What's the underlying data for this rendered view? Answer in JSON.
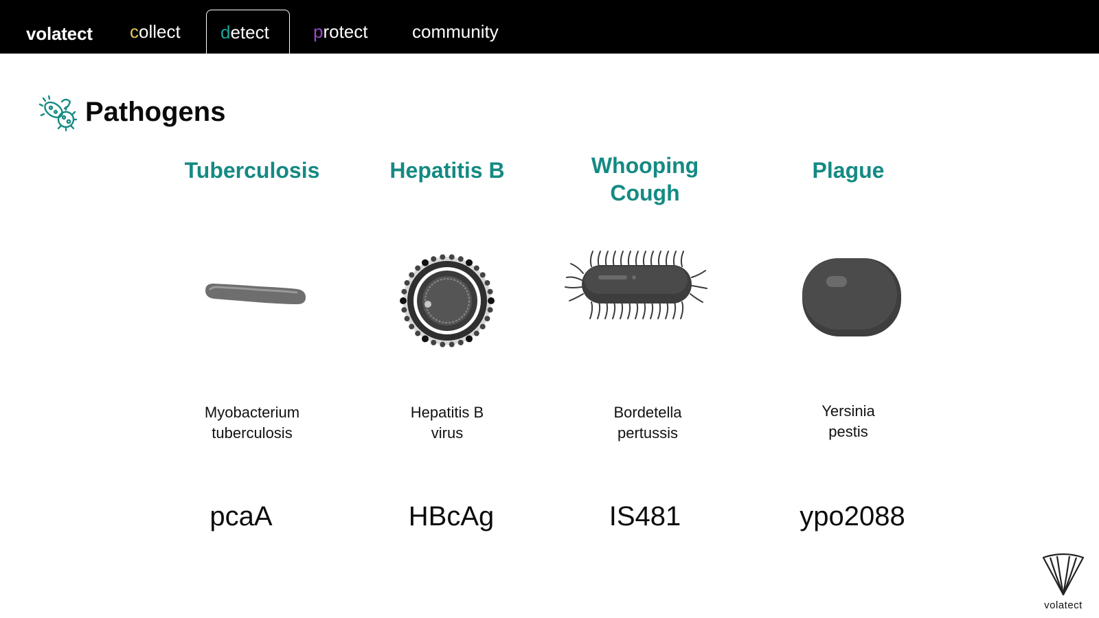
{
  "nav": {
    "brand": "volatect",
    "items": [
      {
        "first": "c",
        "rest": "ollect",
        "first_color": "#e9c75a"
      },
      {
        "first": "d",
        "rest": "etect",
        "first_color": "#1aa79c"
      },
      {
        "first": "p",
        "rest": "rotect",
        "first_color": "#9b47c9"
      },
      {
        "first": "",
        "rest": "community",
        "first_color": "#ffffff"
      }
    ],
    "active": "detect"
  },
  "section": {
    "title": "Pathogens",
    "icon": "microbes-icon"
  },
  "pathogens": [
    {
      "name": "Tuberculosis",
      "icon": "rod-bacterium-icon",
      "species_line1": "Myobacterium",
      "species_line2": "tuberculosis",
      "marker": "pcaA"
    },
    {
      "name": "Hepatitis B",
      "icon": "virus-icon",
      "species_line1": "Hepatitis B",
      "species_line2": "virus",
      "marker": "HBcAg"
    },
    {
      "name_line1": "Whooping",
      "name_line2": "Cough",
      "icon": "flagellated-bacterium-icon",
      "species_line1": "Bordetella",
      "species_line2": "pertussis",
      "marker": "IS481"
    },
    {
      "name": "Plague",
      "icon": "coccobacillus-icon",
      "species_line1": "Yersinia",
      "species_line2": "pestis",
      "marker": "ypo2088"
    }
  ],
  "footer": {
    "logo_text": "volatect",
    "logo_icon": "volatect-logo-icon"
  },
  "colors": {
    "accent": "#148a83",
    "nav_bg": "#000000"
  }
}
